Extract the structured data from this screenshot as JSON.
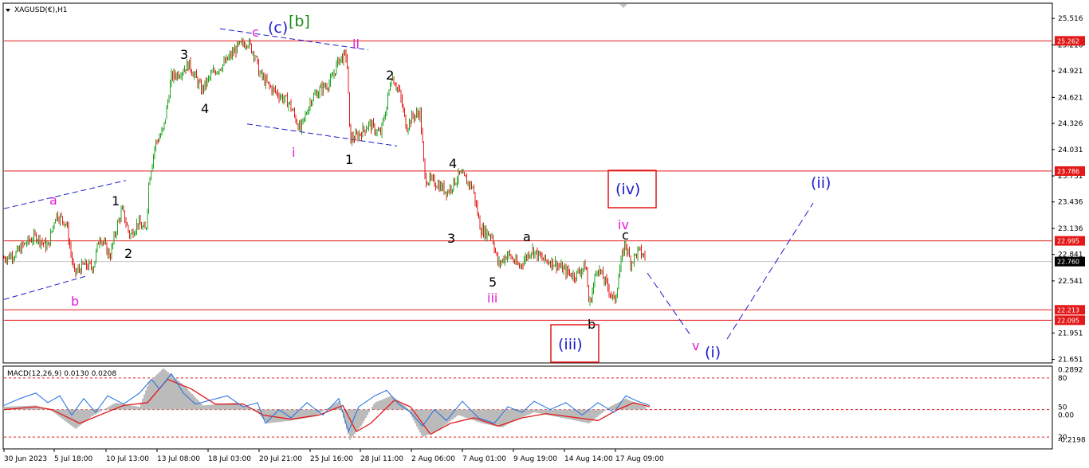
{
  "chart_data": [
    {
      "type": "candlestick",
      "title": "XAGUSD(€),H1",
      "ylim": [
        21.62,
        25.68
      ],
      "y_ticks": [
        "25.516",
        "25.216",
        "24.921",
        "24.621",
        "24.326",
        "24.031",
        "23.731",
        "23.436",
        "23.136",
        "22.841",
        "22.541",
        "21.951",
        "21.651"
      ],
      "x_ticks": [
        "30 Jun 2023",
        "5 Jul 18:00",
        "10 Jul 13:00",
        "13 Jul 08:00",
        "18 Jul 03:00",
        "20 Jul 21:00",
        "25 Jul 16:00",
        "28 Jul 11:00",
        "2 Aug 06:00",
        "7 Aug 01:00",
        "9 Aug 19:00",
        "14 Aug 14:00",
        "17 Aug 09:00"
      ],
      "current_price": "22.760",
      "horizontal_levels": [
        {
          "value": 25.262,
          "label": "25.262",
          "color": "#e31919"
        },
        {
          "value": 23.786,
          "label": "23.786",
          "color": "#e31919"
        },
        {
          "value": 22.995,
          "label": "22.995",
          "color": "#e31919"
        },
        {
          "value": 22.213,
          "label": "22.213",
          "color": "#e31919"
        },
        {
          "value": 22.095,
          "label": "22.095",
          "color": "#e31919"
        }
      ],
      "price_path": [
        [
          0,
          22.8
        ],
        [
          15,
          22.85
        ],
        [
          25,
          22.95
        ],
        [
          40,
          23.05
        ],
        [
          55,
          22.92
        ],
        [
          65,
          23.3
        ],
        [
          78,
          23.2
        ],
        [
          88,
          22.62
        ],
        [
          100,
          22.72
        ],
        [
          112,
          22.7
        ],
        [
          120,
          23.05
        ],
        [
          133,
          22.82
        ],
        [
          140,
          23.1
        ],
        [
          148,
          23.35
        ],
        [
          158,
          23.05
        ],
        [
          168,
          23.2
        ],
        [
          178,
          23.1
        ],
        [
          182,
          23.7
        ],
        [
          190,
          24.1
        ],
        [
          200,
          24.25
        ],
        [
          210,
          24.85
        ],
        [
          220,
          24.9
        ],
        [
          232,
          25.0
        ],
        [
          248,
          24.7
        ],
        [
          262,
          24.9
        ],
        [
          278,
          25.02
        ],
        [
          292,
          25.18
        ],
        [
          305,
          25.26
        ],
        [
          315,
          25.1
        ],
        [
          320,
          24.9
        ],
        [
          332,
          24.75
        ],
        [
          345,
          24.65
        ],
        [
          358,
          24.55
        ],
        [
          372,
          24.25
        ],
        [
          385,
          24.6
        ],
        [
          398,
          24.72
        ],
        [
          410,
          24.8
        ],
        [
          420,
          25.05
        ],
        [
          430,
          25.1
        ],
        [
          434,
          24.15
        ],
        [
          443,
          24.18
        ],
        [
          458,
          24.32
        ],
        [
          472,
          24.2
        ],
        [
          480,
          24.52
        ],
        [
          486,
          24.88
        ],
        [
          496,
          24.68
        ],
        [
          505,
          24.28
        ],
        [
          512,
          24.4
        ],
        [
          522,
          24.45
        ],
        [
          528,
          23.7
        ],
        [
          542,
          23.65
        ],
        [
          556,
          23.55
        ],
        [
          572,
          23.75
        ],
        [
          588,
          23.6
        ],
        [
          598,
          23.12
        ],
        [
          612,
          23.06
        ],
        [
          620,
          22.72
        ],
        [
          632,
          22.85
        ],
        [
          646,
          22.7
        ],
        [
          662,
          22.9
        ],
        [
          676,
          22.78
        ],
        [
          690,
          22.75
        ],
        [
          704,
          22.65
        ],
        [
          716,
          22.6
        ],
        [
          730,
          22.72
        ],
        [
          734,
          22.25
        ],
        [
          744,
          22.7
        ],
        [
          756,
          22.5
        ],
        [
          766,
          22.3
        ],
        [
          772,
          22.65
        ],
        [
          779,
          22.98
        ],
        [
          786,
          22.75
        ],
        [
          796,
          22.88
        ],
        [
          810,
          22.76
        ]
      ]
    },
    {
      "type": "line",
      "title": "MACD(12,26,9) 0.0130 0.0208",
      "ylim": [
        -0.28,
        0.31
      ],
      "y_ticks": [
        "0.2892",
        "80",
        "50",
        "0.00",
        "20",
        "-0.2198"
      ],
      "series": [
        {
          "name": "MACD",
          "color": "#bbbbbb",
          "values": [
            [
              0,
              0.02
            ],
            [
              40,
              0.03
            ],
            [
              60,
              -0.01
            ],
            [
              90,
              -0.14
            ],
            [
              110,
              -0.05
            ],
            [
              140,
              0.05
            ],
            [
              170,
              0.02
            ],
            [
              182,
              0.2
            ],
            [
              200,
              0.3
            ],
            [
              225,
              0.18
            ],
            [
              250,
              0.03
            ],
            [
              290,
              0.05
            ],
            [
              315,
              0.0
            ],
            [
              330,
              -0.1
            ],
            [
              360,
              -0.08
            ],
            [
              390,
              -0.05
            ],
            [
              420,
              0.06
            ],
            [
              434,
              -0.22
            ],
            [
              448,
              -0.12
            ],
            [
              465,
              0.05
            ],
            [
              486,
              0.1
            ],
            [
              505,
              0.02
            ],
            [
              525,
              -0.2
            ],
            [
              545,
              -0.15
            ],
            [
              570,
              -0.04
            ],
            [
              600,
              -0.1
            ],
            [
              625,
              -0.13
            ],
            [
              640,
              -0.08
            ],
            [
              665,
              -0.02
            ],
            [
              700,
              -0.06
            ],
            [
              734,
              -0.1
            ],
            [
              760,
              0.02
            ],
            [
              780,
              0.08
            ],
            [
              795,
              0.04
            ],
            [
              810,
              0.013
            ]
          ]
        },
        {
          "name": "Signal",
          "color": "#e31919",
          "values": [
            [
              0,
              0.0
            ],
            [
              40,
              0.02
            ],
            [
              60,
              0.0
            ],
            [
              95,
              -0.1
            ],
            [
              120,
              -0.04
            ],
            [
              150,
              0.03
            ],
            [
              180,
              0.05
            ],
            [
              205,
              0.22
            ],
            [
              235,
              0.15
            ],
            [
              265,
              0.04
            ],
            [
              300,
              0.04
            ],
            [
              325,
              -0.04
            ],
            [
              360,
              -0.07
            ],
            [
              395,
              -0.04
            ],
            [
              425,
              0.03
            ],
            [
              442,
              -0.16
            ],
            [
              460,
              -0.1
            ],
            [
              490,
              0.07
            ],
            [
              510,
              0.02
            ],
            [
              535,
              -0.18
            ],
            [
              560,
              -0.1
            ],
            [
              590,
              -0.06
            ],
            [
              620,
              -0.12
            ],
            [
              650,
              -0.06
            ],
            [
              680,
              -0.03
            ],
            [
              720,
              -0.06
            ],
            [
              745,
              -0.08
            ],
            [
              770,
              0.0
            ],
            [
              790,
              0.05
            ],
            [
              810,
              0.0208
            ]
          ]
        },
        {
          "name": "Stochastic",
          "color": "#1f6fe0",
          "values": [
            [
              0,
              0.03
            ],
            [
              20,
              0.08
            ],
            [
              40,
              0.12
            ],
            [
              55,
              0.05
            ],
            [
              70,
              0.1
            ],
            [
              85,
              -0.04
            ],
            [
              100,
              0.08
            ],
            [
              115,
              -0.02
            ],
            [
              130,
              0.1
            ],
            [
              150,
              0.04
            ],
            [
              170,
              0.12
            ],
            [
              185,
              0.22
            ],
            [
              195,
              0.15
            ],
            [
              210,
              0.26
            ],
            [
              225,
              0.12
            ],
            [
              240,
              0.04
            ],
            [
              260,
              0.07
            ],
            [
              280,
              0.1
            ],
            [
              300,
              0.02
            ],
            [
              318,
              0.05
            ],
            [
              328,
              -0.1
            ],
            [
              345,
              0.0
            ],
            [
              360,
              -0.06
            ],
            [
              380,
              0.05
            ],
            [
              400,
              -0.04
            ],
            [
              420,
              0.08
            ],
            [
              432,
              -0.16
            ],
            [
              445,
              0.02
            ],
            [
              465,
              0.1
            ],
            [
              480,
              0.14
            ],
            [
              495,
              0.04
            ],
            [
              510,
              -0.02
            ],
            [
              525,
              -0.12
            ],
            [
              540,
              0.0
            ],
            [
              555,
              -0.08
            ],
            [
              575,
              0.06
            ],
            [
              595,
              -0.06
            ],
            [
              615,
              -0.1
            ],
            [
              632,
              0.02
            ],
            [
              650,
              -0.02
            ],
            [
              665,
              0.06
            ],
            [
              685,
              0.0
            ],
            [
              705,
              0.05
            ],
            [
              725,
              -0.04
            ],
            [
              745,
              0.05
            ],
            [
              765,
              -0.02
            ],
            [
              780,
              0.1
            ],
            [
              795,
              0.06
            ],
            [
              810,
              0.03
            ]
          ]
        }
      ]
    }
  ],
  "wave_labels": {
    "top_c": {
      "text": "c",
      "color": "#e619d4"
    },
    "top_paren_c": {
      "text": "(c)",
      "color": "#1a1acc"
    },
    "top_bracket_b": {
      "text": "[b]",
      "color": "#1a8a1a"
    },
    "top_ii": {
      "text": "ii",
      "color": "#e619d4"
    },
    "w_3_top": {
      "text": "3",
      "color": "#000000"
    },
    "w_4_top": {
      "text": "4",
      "color": "#000000"
    },
    "w_i": {
      "text": "i",
      "color": "#e619d4"
    },
    "w_1_mid": {
      "text": "1",
      "color": "#000000"
    },
    "w_2_mid": {
      "text": "2",
      "color": "#000000"
    },
    "w_a_left": {
      "text": "a",
      "color": "#e619d4"
    },
    "w_1_left": {
      "text": "1",
      "color": "#000000"
    },
    "w_2_left": {
      "text": "2",
      "color": "#000000"
    },
    "w_b_left": {
      "text": "b",
      "color": "#e619d4"
    },
    "w_4_mid": {
      "text": "4",
      "color": "#000000"
    },
    "w_3_mid": {
      "text": "3",
      "color": "#000000"
    },
    "w_5": {
      "text": "5",
      "color": "#000000"
    },
    "w_iii": {
      "text": "iii",
      "color": "#e619d4"
    },
    "w_a_right": {
      "text": "a",
      "color": "#000000"
    },
    "w_iv": {
      "text": "iv",
      "color": "#e619d4"
    },
    "w_c_right": {
      "text": "c",
      "color": "#000000"
    },
    "w_b_right": {
      "text": "b",
      "color": "#000000"
    },
    "box_iv": {
      "text": "(iv)",
      "color": "#1a1acc"
    },
    "box_iii": {
      "text": "(iii)",
      "color": "#1a1acc"
    },
    "proj_v": {
      "text": "v",
      "color": "#e619d4"
    },
    "proj_i": {
      "text": "(i)",
      "color": "#1a1acc"
    },
    "proj_ii": {
      "text": "(ii)",
      "color": "#1a1acc"
    }
  },
  "colors": {
    "bull": "#1fa31f",
    "bear": "#e31919",
    "level": "#e31919",
    "channel": "#1a1acc",
    "grid_dot": "#e31919",
    "price_badge": "#000000",
    "level_badge": "#e31919"
  }
}
